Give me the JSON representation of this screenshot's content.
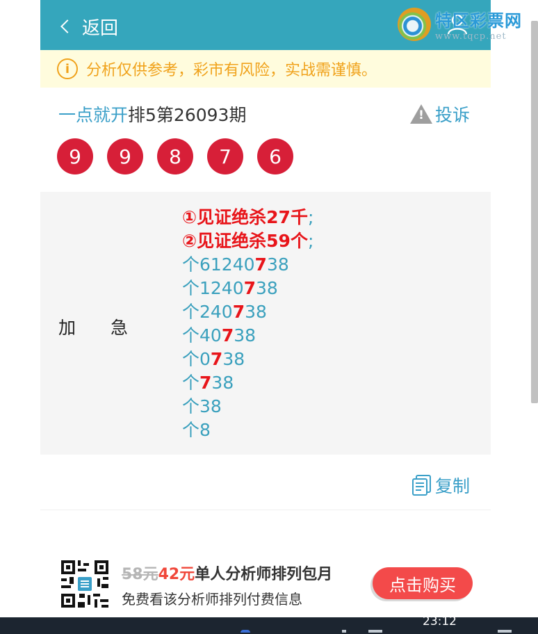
{
  "header": {
    "back_label": "返回",
    "logo_title": "特区彩票网",
    "logo_url": "www.tqcp.net"
  },
  "notice": {
    "icon": "info-icon",
    "text": "分析仅供参考，彩市有风险，实战需谨慎。"
  },
  "post": {
    "author": "一点就开",
    "title_rest": "排5第26093期",
    "report_label": "投诉",
    "balls": [
      "9",
      "9",
      "8",
      "7",
      "6"
    ]
  },
  "analysis": {
    "label_a": "加",
    "label_b": "急",
    "red_lines": [
      {
        "text": "①见证绝杀27千",
        "suffix": ";"
      },
      {
        "text": "②见证绝杀59个",
        "suffix": ";"
      }
    ],
    "lines": [
      {
        "pre": "个61240",
        "hi": "7",
        "post": "38"
      },
      {
        "pre": "个1240",
        "hi": "7",
        "post": "38"
      },
      {
        "pre": "个240",
        "hi": "7",
        "post": "38"
      },
      {
        "pre": "个40",
        "hi": "7",
        "post": "38"
      },
      {
        "pre": "个0",
        "hi": "7",
        "post": "38"
      },
      {
        "pre": "个",
        "hi": "7",
        "post": "38"
      },
      {
        "pre": "个38",
        "hi": "",
        "post": ""
      },
      {
        "pre": "个8",
        "hi": "",
        "post": ""
      }
    ]
  },
  "copy_label": "复制",
  "promo": {
    "old_price": "58元",
    "new_price": "42元",
    "title": "单人分析师排列包月",
    "subtitle": "免费看该分析师排列付费信息",
    "buy_label": "点击购买"
  },
  "taskbar": {
    "clock": "23:12"
  },
  "colors": {
    "header": "#35a6bc",
    "ball": "#d71f38",
    "accent": "#3a9fc8",
    "highlight": "#e8151a",
    "buy": "#f34a4a"
  }
}
